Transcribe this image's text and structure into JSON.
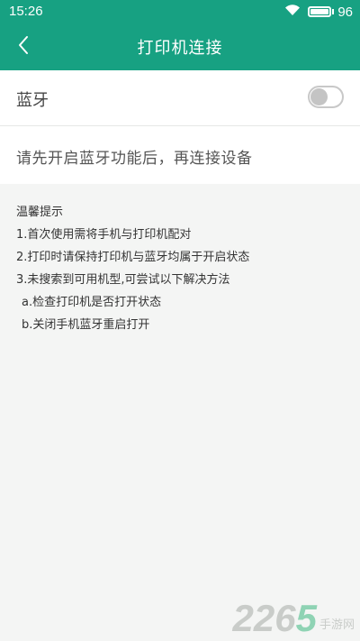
{
  "status_bar": {
    "time": "15:26",
    "battery_percent": "96",
    "battery_level": 0.96,
    "icons": [
      "wifi-icon",
      "battery-icon"
    ]
  },
  "nav": {
    "title": "打印机连接",
    "back_icon": "chevron-left-icon"
  },
  "bluetooth": {
    "label": "蓝牙",
    "enabled": false
  },
  "hint": {
    "text": "请先开启蓝牙功能后，再连接设备"
  },
  "tips": {
    "heading": "温馨提示",
    "items": [
      "1.首次使用需将手机与打印机配对",
      "2.打印时请保持打印机与蓝牙均属于开启状态",
      "3.未搜索到可用机型,可尝试以下解决方法"
    ],
    "sub_items": [
      "a.检查打印机是否打开状态",
      "b.关闭手机蓝牙重启打开"
    ]
  },
  "watermark": {
    "number_part1": "226",
    "number_part2": "5",
    "text": "手游网"
  },
  "colors": {
    "primary": "#17a182",
    "background": "#f4f5f4"
  }
}
